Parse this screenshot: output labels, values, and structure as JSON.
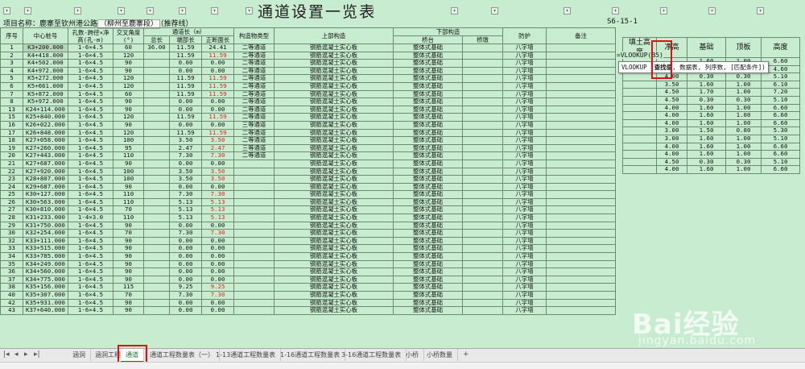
{
  "sheet": {
    "title": "通道设置一览表",
    "project_label": "项目名称：",
    "project_name": "鹿寨至钦州港公路",
    "project_hl": "（柳州至鹿寨段）",
    "project_tail": "（推荐线）",
    "code": "S6-15-1"
  },
  "headers": {
    "seq": "序号",
    "center_stake": "中心桩号",
    "span": "孔数-跨径×净高(孔-m)",
    "angle": "交叉角度(°)",
    "length_group": "通道长（m）",
    "total_len": "总长",
    "end_len": "端部长",
    "normal_len": "正断面长",
    "structure_type": "构造物类型",
    "superstructure": "上部构造",
    "substructure": "下部构造",
    "abutment": "桥台",
    "pier": "桥墩",
    "protection": "防护",
    "remarks": "备注"
  },
  "rows": [
    {
      "n": "1",
      "stake": "K3+200.000",
      "span": "1-6×4.5",
      "ang": "60",
      "tot": "36.00",
      "end": "11.59",
      "norm": "24.41",
      "norm_red": false,
      "type": "二等通道",
      "sup": "钢筋混凝土实心板",
      "abut": "整体式基础",
      "prot": "八字墙"
    },
    {
      "n": "2",
      "stake": "K4+418.000",
      "span": "1-6×4.5",
      "ang": "120",
      "tot": "",
      "end": "11.59",
      "norm": "11.59",
      "norm_red": true,
      "type": "二等通道",
      "sup": "钢筋混凝土实心板",
      "abut": "整体式基础",
      "prot": "八字墙"
    },
    {
      "n": "3",
      "stake": "K4+502.000",
      "span": "1-6×4.5",
      "ang": "90",
      "tot": "",
      "end": "0.00",
      "norm": "0.00",
      "norm_red": false,
      "type": "二等通道",
      "sup": "钢筋混凝土实心板",
      "abut": "整体式基础",
      "prot": "八字墙"
    },
    {
      "n": "4",
      "stake": "K4+972.000",
      "span": "1-6×4.5",
      "ang": "90",
      "tot": "",
      "end": "0.00",
      "norm": "0.00",
      "norm_red": false,
      "type": "二等通道",
      "sup": "钢筋混凝土实心板",
      "abut": "整体式基础",
      "prot": "八字墙"
    },
    {
      "n": "5",
      "stake": "K5+272.000",
      "span": "1-6×4.5",
      "ang": "120",
      "tot": "",
      "end": "11.59",
      "norm": "11.59",
      "norm_red": true,
      "type": "二等通道",
      "sup": "钢筋混凝土实心板",
      "abut": "整体式基础",
      "prot": "八字墙"
    },
    {
      "n": "6",
      "stake": "K5+661.000",
      "span": "1-6×4.5",
      "ang": "120",
      "tot": "",
      "end": "11.59",
      "norm": "11.59",
      "norm_red": true,
      "type": "二等通道",
      "sup": "钢筋混凝土实心板",
      "abut": "整体式基础",
      "prot": "八字墙"
    },
    {
      "n": "7",
      "stake": "K5+872.000",
      "span": "1-6×4.5",
      "ang": "60",
      "tot": "",
      "end": "11.59",
      "norm": "11.59",
      "norm_red": true,
      "type": "二等通道",
      "sup": "钢筋混凝土实心板",
      "abut": "整体式基础",
      "prot": "八字墙"
    },
    {
      "n": "8",
      "stake": "K5+972.000",
      "span": "1-6×4.5",
      "ang": "90",
      "tot": "",
      "end": "0.00",
      "norm": "0.00",
      "norm_red": false,
      "type": "二等通道",
      "sup": "钢筋混凝土实心板",
      "abut": "整体式基础",
      "prot": "八字墙"
    },
    {
      "n": "13",
      "stake": "K24+114.000",
      "span": "1-6×4.5",
      "ang": "90",
      "tot": "",
      "end": "0.00",
      "norm": "0.00",
      "norm_red": false,
      "type": "二等通道",
      "sup": "钢筋混凝土实心板",
      "abut": "整体式基础",
      "prot": "八字墙"
    },
    {
      "n": "15",
      "stake": "K25+840.000",
      "span": "1-6×4.5",
      "ang": "120",
      "tot": "",
      "end": "11.59",
      "norm": "11.59",
      "norm_red": true,
      "type": "二等通道",
      "sup": "钢筋混凝土实心板",
      "abut": "整体式基础",
      "prot": "八字墙"
    },
    {
      "n": "16",
      "stake": "K26+022.000",
      "span": "1-6×4.5",
      "ang": "90",
      "tot": "",
      "end": "0.00",
      "norm": "0.00",
      "norm_red": false,
      "type": "三等通道",
      "sup": "钢筋混凝土实心板",
      "abut": "整体式基础",
      "prot": "八字墙"
    },
    {
      "n": "17",
      "stake": "K26+848.000",
      "span": "1-6×4.5",
      "ang": "120",
      "tot": "",
      "end": "11.59",
      "norm": "11.59",
      "norm_red": true,
      "type": "二等通道",
      "sup": "钢筋混凝土实心板",
      "abut": "整体式基础",
      "prot": "八字墙"
    },
    {
      "n": "18",
      "stake": "K27+058.000",
      "span": "1-6×4.5",
      "ang": "100",
      "tot": "",
      "end": "3.50",
      "norm": "3.50",
      "norm_red": true,
      "type": "二等通道",
      "sup": "钢筋混凝土实心板",
      "abut": "整体式基础",
      "prot": "八字墙"
    },
    {
      "n": "19",
      "stake": "K27+260.000",
      "span": "1-6×4.5",
      "ang": "95",
      "tot": "",
      "end": "2.47",
      "norm": "2.47",
      "norm_red": true,
      "type": "三等通道",
      "sup": "钢筋混凝土实心板",
      "abut": "整体式基础",
      "prot": "八字墙"
    },
    {
      "n": "20",
      "stake": "K27+443.000",
      "span": "1-6×4.5",
      "ang": "110",
      "tot": "",
      "end": "7.30",
      "norm": "7.30",
      "norm_red": true,
      "type": "二等通道",
      "sup": "钢筋混凝土实心板",
      "abut": "整体式基础",
      "prot": "八字墙"
    },
    {
      "n": "21",
      "stake": "K27+687.000",
      "span": "1-6×4.5",
      "ang": "90",
      "tot": "",
      "end": "0.00",
      "norm": "0.00",
      "norm_red": false,
      "type": "",
      "sup": "钢筋混凝土实心板",
      "abut": "整体式基础",
      "prot": "八字墙"
    },
    {
      "n": "22",
      "stake": "K27+920.000",
      "span": "1-6×4.5",
      "ang": "100",
      "tot": "",
      "end": "3.50",
      "norm": "3.50",
      "norm_red": true,
      "type": "",
      "sup": "钢筋混凝土实心板",
      "abut": "整体式基础",
      "prot": "八字墙"
    },
    {
      "n": "23",
      "stake": "K28+807.000",
      "span": "1-6×4.5",
      "ang": "100",
      "tot": "",
      "end": "3.50",
      "norm": "3.50",
      "norm_red": true,
      "type": "",
      "sup": "钢筋混凝土实心板",
      "abut": "整体式基础",
      "prot": "八字墙"
    },
    {
      "n": "24",
      "stake": "K29+687.000",
      "span": "1-6×4.5",
      "ang": "90",
      "tot": "",
      "end": "0.00",
      "norm": "0.00",
      "norm_red": false,
      "type": "",
      "sup": "钢筋混凝土实心板",
      "abut": "整体式基础",
      "prot": "八字墙"
    },
    {
      "n": "25",
      "stake": "K30+127.000",
      "span": "1-6×4.5",
      "ang": "110",
      "tot": "",
      "end": "7.30",
      "norm": "7.30",
      "norm_red": true,
      "type": "",
      "sup": "钢筋混凝土实心板",
      "abut": "整体式基础",
      "prot": "八字墙"
    },
    {
      "n": "26",
      "stake": "K30+563.000",
      "span": "1-6×4.5",
      "ang": "110",
      "tot": "",
      "end": "5.13",
      "norm": "5.13",
      "norm_red": true,
      "type": "",
      "sup": "钢筋混凝土实心板",
      "abut": "整体式基础",
      "prot": "八字墙"
    },
    {
      "n": "27",
      "stake": "K30+810.000",
      "span": "1-6×4.5",
      "ang": "70",
      "tot": "",
      "end": "5.13",
      "norm": "5.13",
      "norm_red": true,
      "type": "",
      "sup": "钢筋混凝土实心板",
      "abut": "整体式基础",
      "prot": "八字墙"
    },
    {
      "n": "28",
      "stake": "K31+233.000",
      "span": "1-4×3.0",
      "ang": "110",
      "tot": "",
      "end": "5.13",
      "norm": "5.13",
      "norm_red": true,
      "type": "",
      "sup": "钢筋混凝土实心板",
      "abut": "整体式基础",
      "prot": "八字墙"
    },
    {
      "n": "29",
      "stake": "K31+750.000",
      "span": "1-6×4.5",
      "ang": "90",
      "tot": "",
      "end": "0.00",
      "norm": "0.00",
      "norm_red": false,
      "type": "",
      "sup": "钢筋混凝土实心板",
      "abut": "整体式基础",
      "prot": "八字墙"
    },
    {
      "n": "30",
      "stake": "K32+254.000",
      "span": "1-6×4.5",
      "ang": "70",
      "tot": "",
      "end": "7.30",
      "norm": "7.30",
      "norm_red": true,
      "type": "",
      "sup": "钢筋混凝土实心板",
      "abut": "整体式基础",
      "prot": "八字墙"
    },
    {
      "n": "32",
      "stake": "K33+111.000",
      "span": "1-6×4.5",
      "ang": "90",
      "tot": "",
      "end": "0.00",
      "norm": "0.00",
      "norm_red": false,
      "type": "",
      "sup": "钢筋混凝土实心板",
      "abut": "整体式基础",
      "prot": "八字墙"
    },
    {
      "n": "33",
      "stake": "K33+515.000",
      "span": "1-6×4.5",
      "ang": "90",
      "tot": "",
      "end": "0.00",
      "norm": "0.00",
      "norm_red": false,
      "type": "",
      "sup": "钢筋混凝土实心板",
      "abut": "整体式基础",
      "prot": "八字墙"
    },
    {
      "n": "34",
      "stake": "K33+785.000",
      "span": "1-6×4.5",
      "ang": "90",
      "tot": "",
      "end": "0.00",
      "norm": "0.00",
      "norm_red": false,
      "type": "",
      "sup": "钢筋混凝土实心板",
      "abut": "整体式基础",
      "prot": "八字墙"
    },
    {
      "n": "35",
      "stake": "K34+249.000",
      "span": "1-6×4.5",
      "ang": "90",
      "tot": "",
      "end": "0.00",
      "norm": "0.00",
      "norm_red": false,
      "type": "",
      "sup": "钢筋混凝土实心板",
      "abut": "整体式基础",
      "prot": "八字墙"
    },
    {
      "n": "36",
      "stake": "K34+560.000",
      "span": "1-6×4.5",
      "ang": "90",
      "tot": "",
      "end": "0.00",
      "norm": "0.00",
      "norm_red": false,
      "type": "",
      "sup": "钢筋混凝土实心板",
      "abut": "整体式基础",
      "prot": "八字墙"
    },
    {
      "n": "37",
      "stake": "K34+775.000",
      "span": "1-6×4.5",
      "ang": "90",
      "tot": "",
      "end": "0.00",
      "norm": "0.00",
      "norm_red": false,
      "type": "",
      "sup": "钢筋混凝土实心板",
      "abut": "整体式基础",
      "prot": "八字墙"
    },
    {
      "n": "38",
      "stake": "K35+156.000",
      "span": "1-6×4.5",
      "ang": "115",
      "tot": "",
      "end": "9.25",
      "norm": "9.25",
      "norm_red": true,
      "type": "",
      "sup": "钢筋混凝土实心板",
      "abut": "整体式基础",
      "prot": "八字墙"
    },
    {
      "n": "40",
      "stake": "K35+307.000",
      "span": "1-6×4.5",
      "ang": "70",
      "tot": "",
      "end": "7.30",
      "norm": "7.30",
      "norm_red": true,
      "type": "",
      "sup": "钢筋混凝土实心板",
      "abut": "整体式基础",
      "prot": "八字墙"
    },
    {
      "n": "42",
      "stake": "K35+931.000",
      "span": "1-6×4.5",
      "ang": "90",
      "tot": "",
      "end": "0.00",
      "norm": "0.00",
      "norm_red": false,
      "type": "",
      "sup": "钢筋混凝土实心板",
      "abut": "整体式基础",
      "prot": "八字墙"
    },
    {
      "n": "43",
      "stake": "K37+640.000",
      "span": "1-6×4.5",
      "ang": "90",
      "tot": "",
      "end": "0.00",
      "norm": "0.00",
      "norm_red": false,
      "type": "",
      "sup": "钢筋混凝土实心板",
      "abut": "整体式基础",
      "prot": "八字墙"
    }
  ],
  "side_table": {
    "headers": [
      "填土高度",
      "净高",
      "基础",
      "顶板",
      "高度"
    ],
    "formula": "=VLOOKUP(B5)",
    "tooltip_func": "VLOOKUP",
    "tooltip_arg1": "查找值",
    "tooltip_rest": ", 数据表, 列序数, [匹配条件])",
    "rows": [
      [
        "",
        "",
        "1.60",
        "1.00",
        "6.60"
      ],
      [
        "",
        "4.00",
        "0.30",
        "0.30",
        "4.60"
      ],
      [
        "",
        "4.00",
        "0.30",
        "0.30",
        "5.10"
      ],
      [
        "",
        "3.50",
        "1.60",
        "1.00",
        "6.10"
      ],
      [
        "",
        "4.50",
        "1.70",
        "1.00",
        "7.20"
      ],
      [
        "",
        "4.50",
        "0.30",
        "0.30",
        "5.10"
      ],
      [
        "",
        "4.00",
        "1.60",
        "1.00",
        "6.60"
      ],
      [
        "",
        "4.00",
        "1.60",
        "1.00",
        "6.60"
      ],
      [
        "",
        "4.00",
        "1.60",
        "1.00",
        "6.60"
      ],
      [
        "",
        "3.00",
        "1.50",
        "0.80",
        "5.30"
      ],
      [
        "",
        "3.00",
        "1.60",
        "1.00",
        "5.10"
      ],
      [
        "",
        "4.00",
        "1.60",
        "1.00",
        "6.60"
      ],
      [
        "",
        "4.00",
        "1.60",
        "1.00",
        "6.60"
      ],
      [
        "",
        "4.50",
        "0.30",
        "0.30",
        "5.10"
      ],
      [
        "",
        "4.00",
        "1.60",
        "1.00",
        "6.60"
      ]
    ],
    "last_value": "2.3"
  },
  "tabs": [
    "涵洞",
    "涵洞工程数量表",
    "通道",
    "通道工程数量表（一）",
    "1-13通道工程数量表",
    "1-16通道工程数量表",
    "3-16通道工程数量表",
    "小桥",
    "小桥数量"
  ],
  "active_tab": "通道",
  "watermark": {
    "big": "Bai经验",
    "small": "jingyan.baidu.com"
  }
}
